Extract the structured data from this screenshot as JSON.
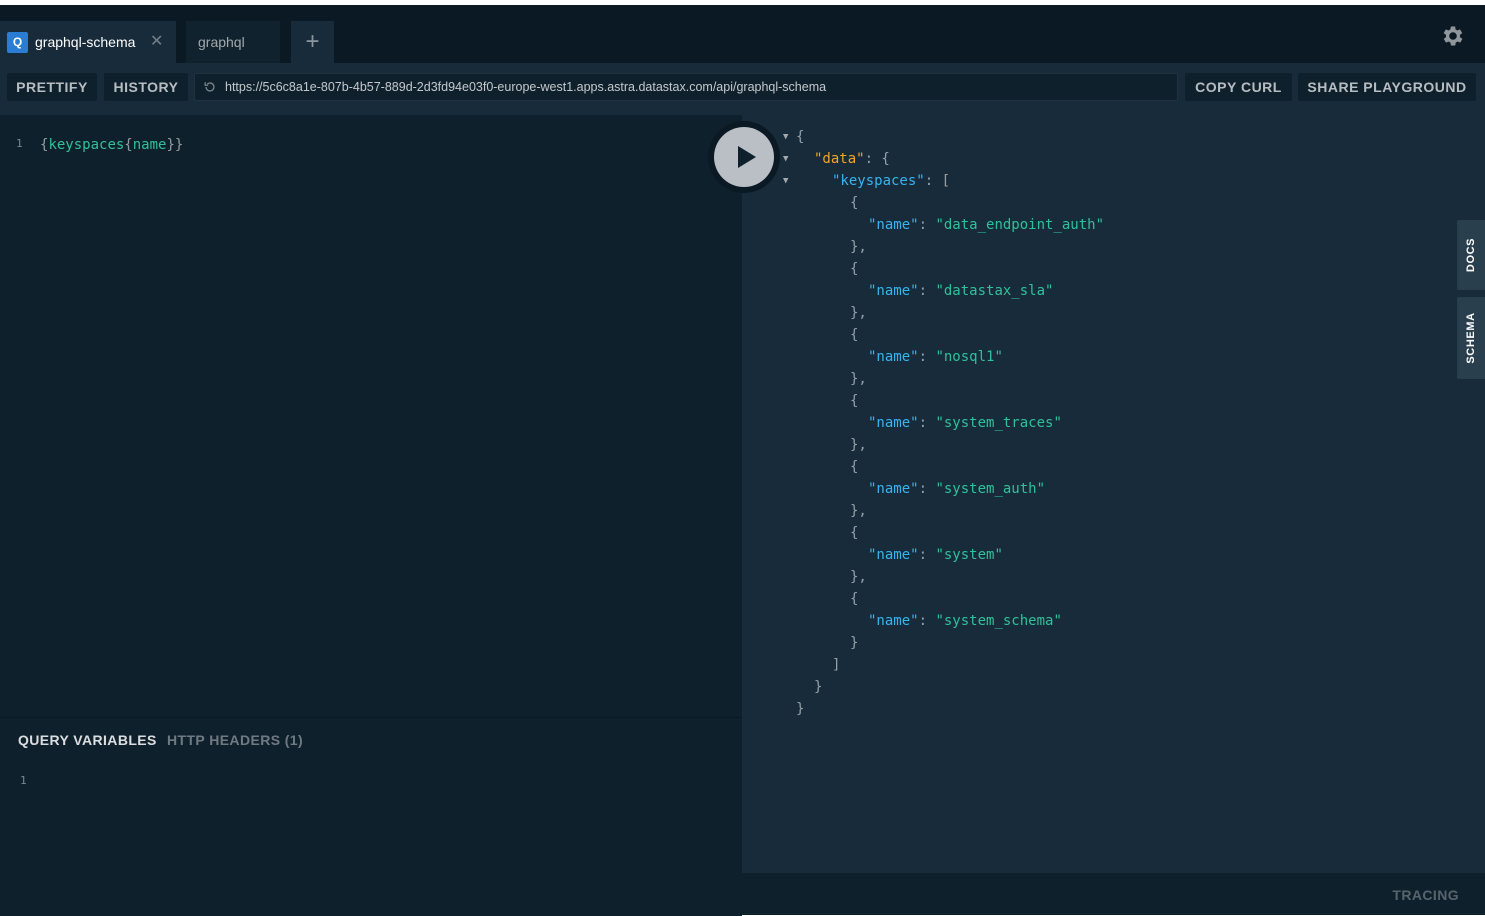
{
  "tabs": [
    {
      "badge": "Q",
      "label": "graphql-schema",
      "active": true
    },
    {
      "label": "graphql",
      "active": false
    }
  ],
  "toolbar": {
    "prettify_label": "PRETTIFY",
    "history_label": "HISTORY",
    "url": "https://5c6c8a1e-807b-4b57-889d-2d3fd94e03f0-europe-west1.apps.astra.datastax.com/api/graphql-schema",
    "copy_curl_label": "COPY CURL",
    "share_label": "SHARE PLAYGROUND"
  },
  "editor": {
    "line_number": "1",
    "query_open": "{",
    "query_field1": "keyspaces",
    "query_brace": "{",
    "query_field2": "name",
    "query_close": "}}"
  },
  "variables": {
    "tab_variables": "QUERY VARIABLES",
    "tab_headers": "HTTP HEADERS (1)",
    "line_number": "1"
  },
  "result": {
    "data_key": "\"data\"",
    "keyspaces_key": "\"keyspaces\"",
    "name_key": "\"name\"",
    "names": [
      "\"data_endpoint_auth\"",
      "\"datastax_sla\"",
      "\"nosql1\"",
      "\"system_traces\"",
      "\"system_auth\"",
      "\"system\"",
      "\"system_schema\""
    ]
  },
  "side_tabs": {
    "docs": "DOCS",
    "schema": "SCHEMA"
  },
  "footer": {
    "tracing": "TRACING"
  },
  "icons": [
    "close-icon",
    "plus-icon",
    "gear-icon",
    "reload-icon",
    "play-icon",
    "fold-arrow-icon"
  ],
  "colors": {
    "accent_blue": "#2b7cd3",
    "key_orange": "#f5a623",
    "key_blue": "#37b4f3",
    "string_green": "#2ec29a"
  }
}
